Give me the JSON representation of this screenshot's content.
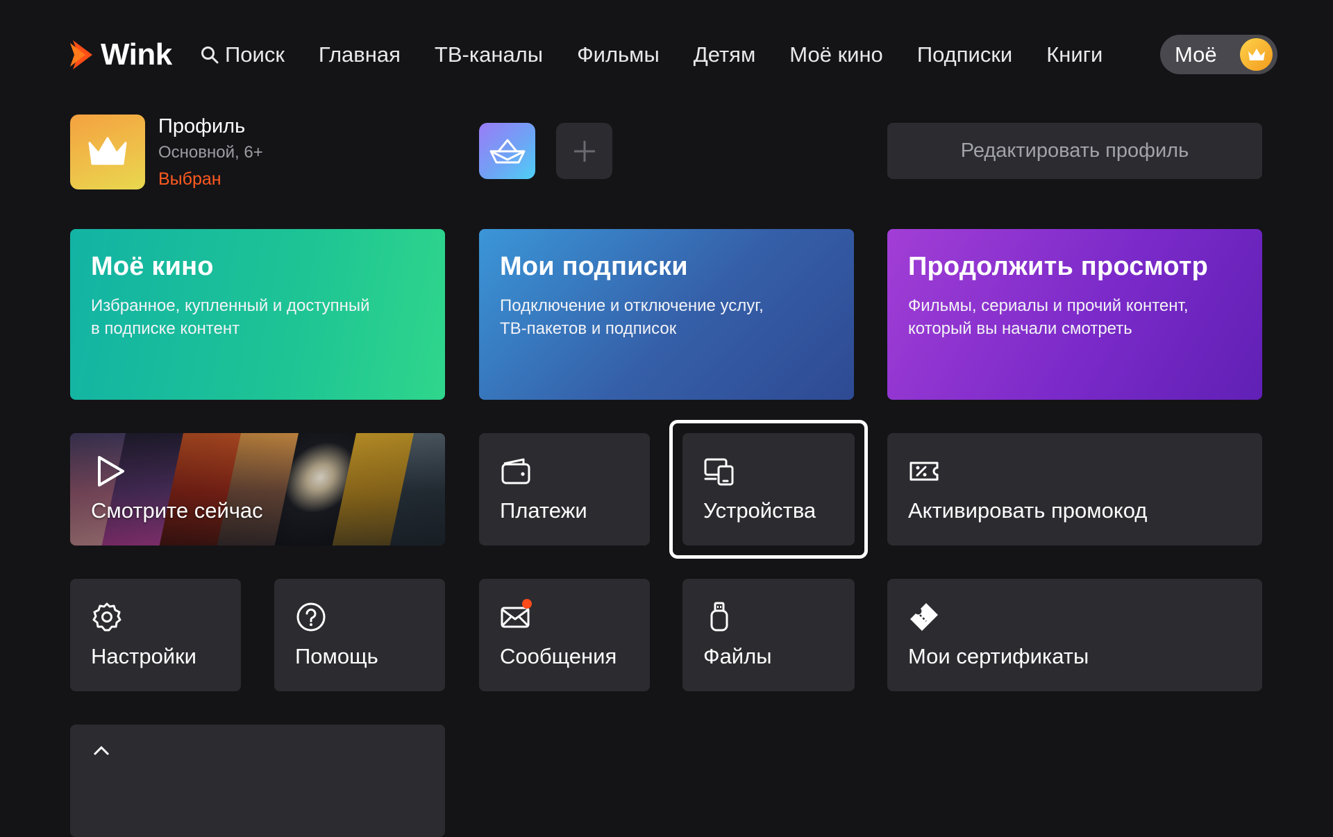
{
  "header": {
    "logo_text": "Wink",
    "nav": {
      "search": "Поиск",
      "items": [
        "Главная",
        "ТВ-каналы",
        "Фильмы",
        "Детям",
        "Моё кино",
        "Подписки",
        "Книги"
      ]
    },
    "moe_label": "Моё"
  },
  "profile": {
    "name": "Профиль",
    "subtitle": "Основной, 6+",
    "status": "Выбран",
    "edit_label": "Редактировать профиль"
  },
  "cards": [
    {
      "title": "Моё кино",
      "desc1": "Избранное, купленный и доступный",
      "desc2": "в подписке контент"
    },
    {
      "title": "Мои подписки",
      "desc1": "Подключение и отключение услуг,",
      "desc2": "ТВ-пакетов и подписок"
    },
    {
      "title": "Продолжить просмотр",
      "desc1": "Фильмы, сериалы и прочий контент,",
      "desc2": "который вы начали смотреть"
    }
  ],
  "tiles": {
    "watch_now": "Смотрите сейчас",
    "payments": "Платежи",
    "devices": "Устройства",
    "promo": "Активировать промокод",
    "settings": "Настройки",
    "help": "Помощь",
    "messages": "Сообщения",
    "files": "Файлы",
    "certificates": "Мои сертификаты"
  },
  "colors": {
    "background": "#141417",
    "tile": "#2b2b30",
    "accent_orange": "#ff5a1f",
    "selected_status": "#ff5a1f"
  },
  "focused_tile": "devices",
  "icons": {
    "payments": "wallet-icon",
    "devices": "devices-icon",
    "promo": "promo-ticket-icon",
    "settings": "gear-icon",
    "help": "question-icon",
    "messages": "mail-icon",
    "files": "usb-drive-icon",
    "certificates": "certificate-icon"
  }
}
